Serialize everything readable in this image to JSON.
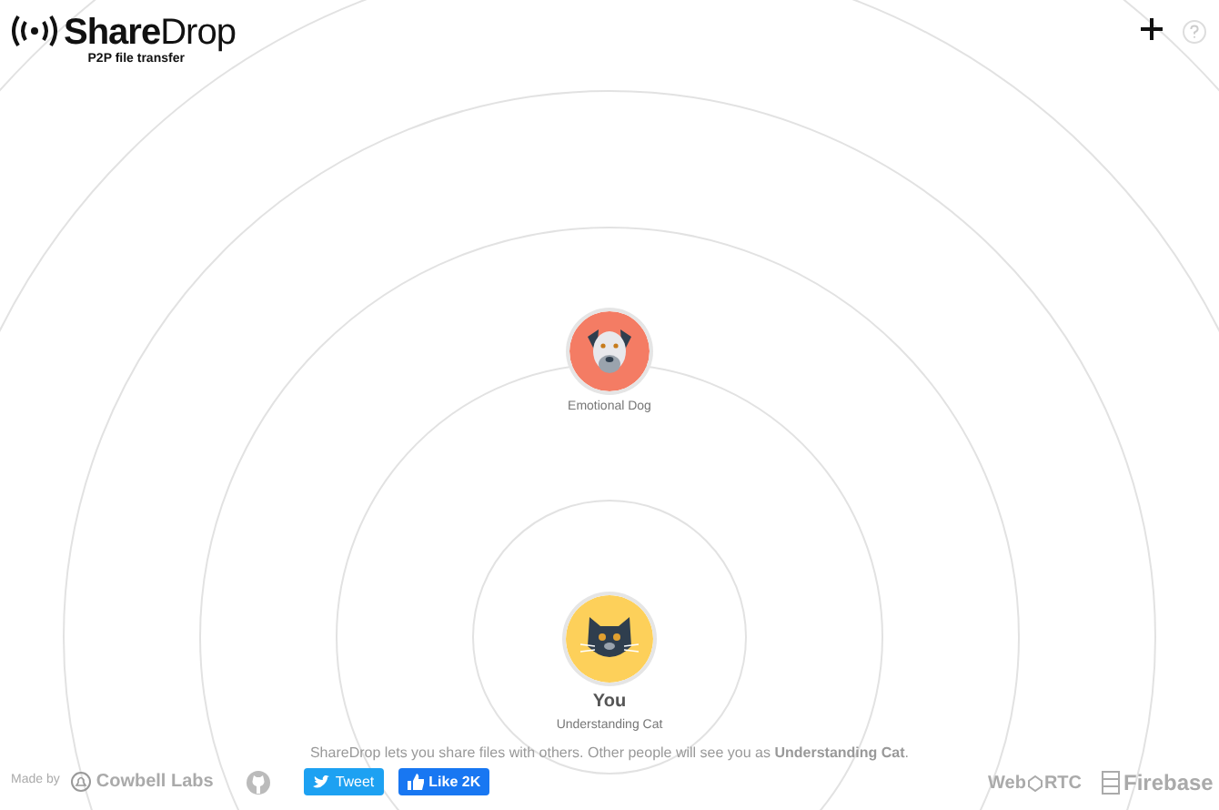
{
  "logo": {
    "title": "**Share**Drop",
    "subtitle": "P2P file transfer"
  },
  "peers": [
    {
      "name": "Emotional Dog",
      "kind": "dog"
    }
  ],
  "me": {
    "label": "You",
    "name": "Understanding Cat",
    "kind": "cat"
  },
  "info": "ShareDrop lets you share files with others. Other people will see you as **Understanding Cat**.",
  "footer": {
    "made_by": "Made by",
    "company": "Cowbell Labs",
    "tweet": "Tweet",
    "like": "Like 2K",
    "webrtc_left": "Web",
    "webrtc_right": "RTC",
    "firebase": "Firebase"
  }
}
